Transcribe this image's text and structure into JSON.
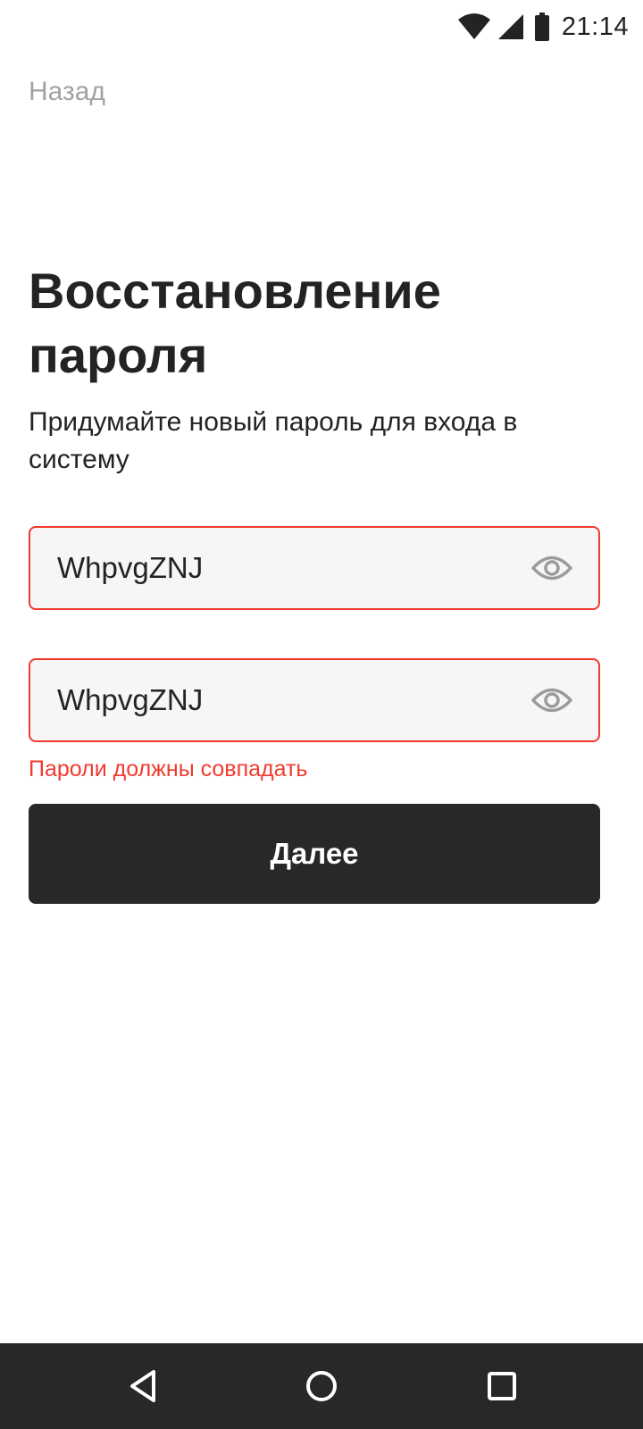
{
  "status_bar": {
    "time": "21:14",
    "icons": [
      "wifi-icon",
      "cell-signal-icon",
      "battery-icon"
    ]
  },
  "header": {
    "back_label": "Назад"
  },
  "main": {
    "title_line1": "Восстановление",
    "title_line2": "пароля",
    "subtitle_line1": "Придумайте новый пароль для входа в",
    "subtitle_line2": "систему",
    "password_field": {
      "value": "WhpvgZNJ",
      "icon": "eye-icon"
    },
    "confirm_field": {
      "value": "WhpvgZNJ",
      "icon": "eye-icon"
    },
    "error_message": "Пароли должны совпадать",
    "next_label": "Далее"
  },
  "nav_bar": {
    "icons": [
      "back-triangle-icon",
      "home-circle-icon",
      "recents-square-icon"
    ]
  },
  "colors": {
    "error": "#f23a2f",
    "button_bg": "#27282a",
    "field_bg": "#f6f6f6",
    "text": "#222325",
    "muted": "#a2a2a4"
  }
}
